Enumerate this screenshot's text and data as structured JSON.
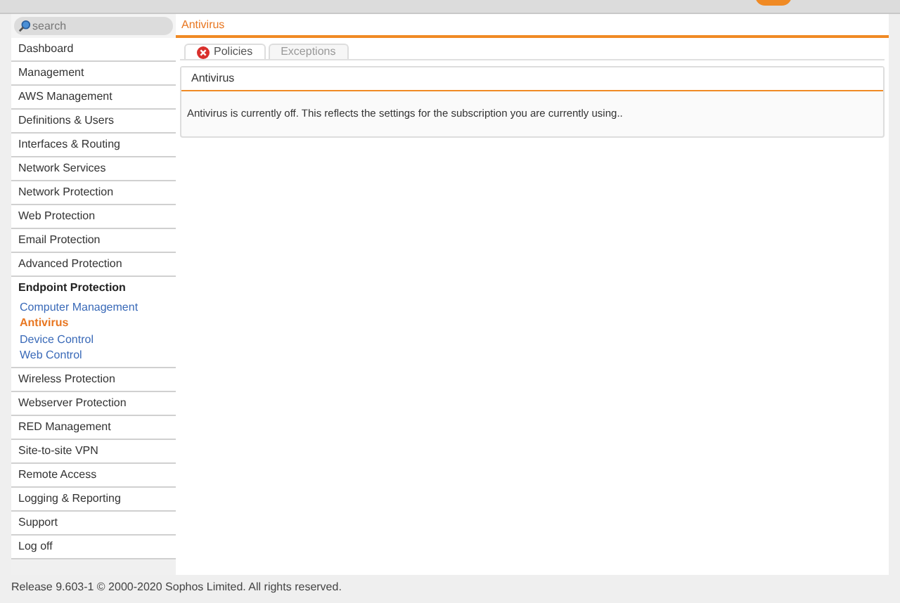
{
  "search": {
    "placeholder": "search"
  },
  "sidebar": {
    "items": [
      {
        "label": "Dashboard",
        "expanded": false
      },
      {
        "label": "Management",
        "expanded": false
      },
      {
        "label": "AWS Management",
        "expanded": false
      },
      {
        "label": "Definitions & Users",
        "expanded": false
      },
      {
        "label": "Interfaces & Routing",
        "expanded": false
      },
      {
        "label": "Network Services",
        "expanded": false
      },
      {
        "label": "Network Protection",
        "expanded": false
      },
      {
        "label": "Web Protection",
        "expanded": false
      },
      {
        "label": "Email Protection",
        "expanded": false
      },
      {
        "label": "Advanced Protection",
        "expanded": false
      },
      {
        "label": "Endpoint Protection",
        "expanded": true,
        "children": [
          {
            "label": "Computer Management",
            "selected": false
          },
          {
            "label": "Antivirus",
            "selected": true
          },
          {
            "label": "Device Control",
            "selected": false
          },
          {
            "label": "Web Control",
            "selected": false
          }
        ]
      },
      {
        "label": "Wireless Protection",
        "expanded": false
      },
      {
        "label": "Webserver Protection",
        "expanded": false
      },
      {
        "label": "RED Management",
        "expanded": false
      },
      {
        "label": "Site-to-site VPN",
        "expanded": false
      },
      {
        "label": "Remote Access",
        "expanded": false
      },
      {
        "label": "Logging & Reporting",
        "expanded": false
      },
      {
        "label": "Support",
        "expanded": false
      },
      {
        "label": "Log off",
        "expanded": false
      }
    ]
  },
  "page_title": "Antivirus",
  "tabs": [
    {
      "label": "Policies",
      "selected": true
    },
    {
      "label": "Exceptions",
      "selected": false
    }
  ],
  "panel": {
    "title": "Antivirus",
    "message": "Antivirus is currently off. This reflects the settings for the subscription you are currently using.."
  },
  "footer": "Release 9.603-1  © 2000-2020 Sophos Limited. All rights reserved."
}
